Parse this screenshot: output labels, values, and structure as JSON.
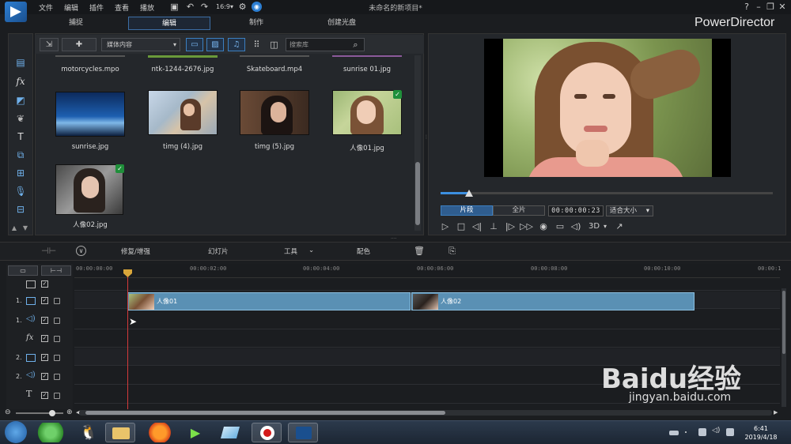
{
  "menu": [
    "文件",
    "编辑",
    "插件",
    "查看",
    "播放"
  ],
  "window_title": "未命名的新项目*",
  "brand": "PowerDirector",
  "mode_tabs": [
    "捕捉",
    "编辑",
    "制作",
    "创建光盘"
  ],
  "active_mode": "编辑",
  "library": {
    "filter_dropdown": "媒体内容",
    "search_placeholder": "搜索库",
    "top_row_labels": [
      "motorcycles.mpo",
      "ntk-1244-2676.jpg",
      "Skateboard.mp4",
      "sunrise 01.jpg"
    ],
    "items": [
      {
        "label": "sunrise.jpg",
        "checked": false
      },
      {
        "label": "timg (4).jpg",
        "checked": false
      },
      {
        "label": "timg (5).jpg",
        "checked": false
      },
      {
        "label": "人像01.jpg",
        "checked": true
      },
      {
        "label": "人像02.jpg",
        "checked": true
      }
    ]
  },
  "preview": {
    "segment_btn": "片段",
    "full_btn": "全片",
    "timecode": "00:00:00:23",
    "fit_option": "适合大小",
    "mode_3d": "3D"
  },
  "timeline_toolbar": {
    "repair": "修复/增强",
    "slideshow": "幻灯片",
    "tools": "工具",
    "color": "配色"
  },
  "ruler_ticks": [
    "00:00:00:00",
    "00:00:02:00",
    "00:00:04:00",
    "00:00:06:00",
    "00:00:08:00",
    "00:00:10:00",
    "00:00:1"
  ],
  "tracks": [
    {
      "num": "",
      "type": "master"
    },
    {
      "num": "1.",
      "type": "video"
    },
    {
      "num": "1.",
      "type": "audio"
    },
    {
      "num": "",
      "type": "fx"
    },
    {
      "num": "2.",
      "type": "video"
    },
    {
      "num": "2.",
      "type": "audio"
    },
    {
      "num": "",
      "type": "title"
    }
  ],
  "clips": [
    {
      "label": "人像01",
      "track": 1
    },
    {
      "label": "人像02",
      "track": 1
    }
  ],
  "taskbar": {
    "time": "6:41",
    "date": "2019/4/18"
  },
  "watermark": {
    "brand": "Baidu经验",
    "url": "jingyan.baidu.com"
  }
}
